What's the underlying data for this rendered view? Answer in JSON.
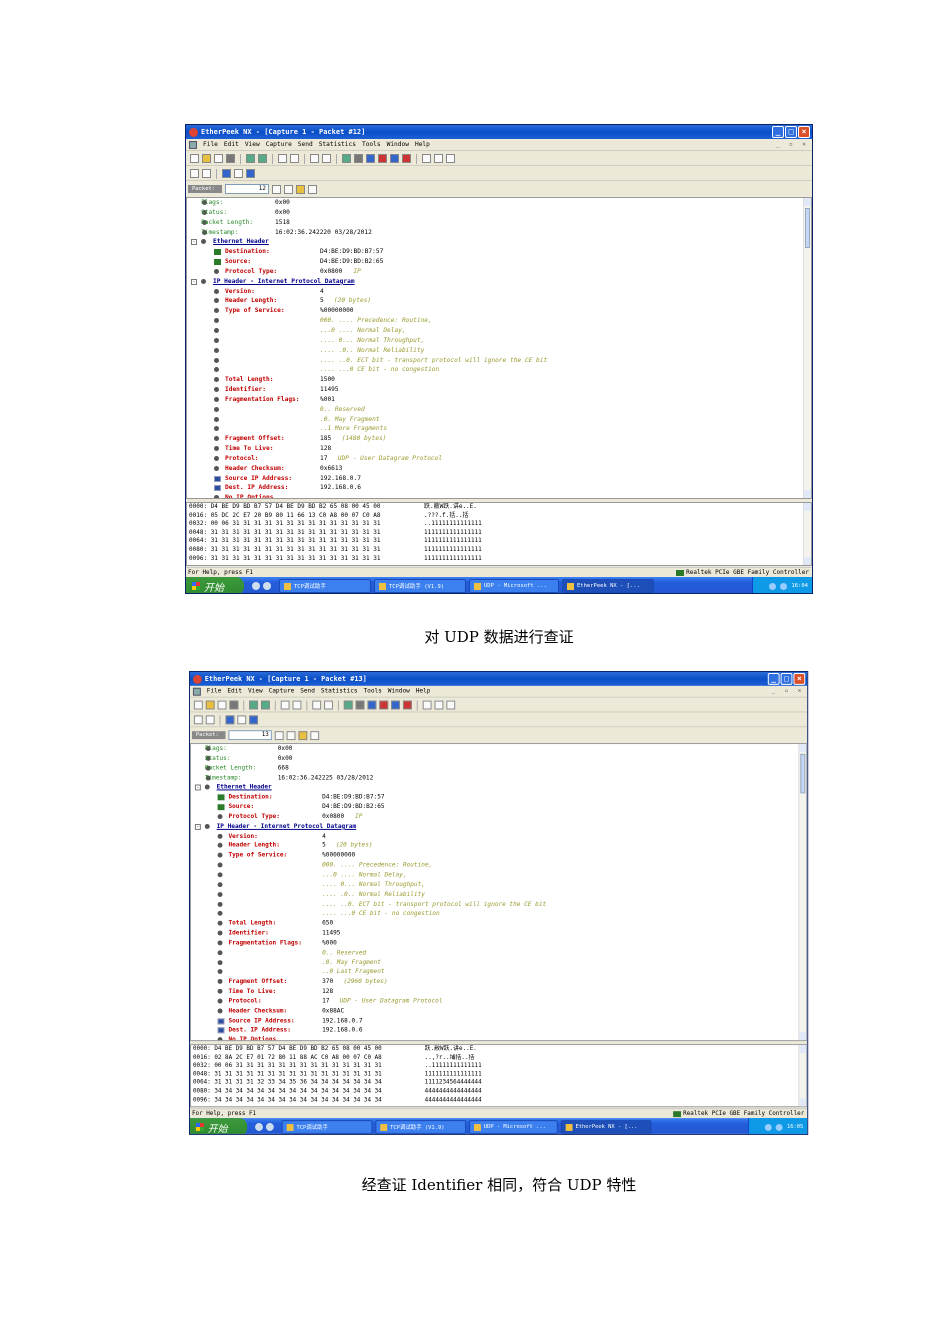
{
  "windows": [
    {
      "title": "EtherPeek NX - [Capture 1 - Packet #12]",
      "menu": [
        "File",
        "Edit",
        "View",
        "Capture",
        "Send",
        "Statistics",
        "Tools",
        "Window",
        "Help"
      ],
      "packet_label": "Packet:",
      "packet_number": "12",
      "tree": [
        {
          "k": "g",
          "l": "Flags:",
          "v": "0x00"
        },
        {
          "k": "g",
          "l": "Status:",
          "v": "0x00"
        },
        {
          "k": "g",
          "l": "Packet Length:",
          "v": "1518"
        },
        {
          "k": "g",
          "l": "Timestamp:",
          "v": "16:02:36.242220 03/28/2012"
        },
        {
          "k": "h",
          "l": "Ethernet Header"
        },
        {
          "k": "f",
          "i": "nic",
          "l": "Destination:",
          "v": "D4:BE:D9:BD:B7:57"
        },
        {
          "k": "f",
          "i": "nic",
          "l": "Source:",
          "v": "D4:BE:D9:BD:B2:65"
        },
        {
          "k": "f",
          "l": "Protocol Type:",
          "v": "0x0800",
          "n": "IP"
        },
        {
          "k": "h",
          "l": "IP Header - Internet Protocol Datagram"
        },
        {
          "k": "f",
          "l": "Version:",
          "v": "4"
        },
        {
          "k": "f",
          "l": "Header Length:",
          "v": "5",
          "n": "(20  bytes)"
        },
        {
          "k": "f",
          "l": "Type of Service:",
          "v": "%00000000"
        },
        {
          "k": "b",
          "n": "000. .... Precedence: Routine,"
        },
        {
          "k": "b",
          "n": "...0 .... Normal Delay,"
        },
        {
          "k": "b",
          "n": ".... 0... Normal Throughput,"
        },
        {
          "k": "b",
          "n": ".... .0.. Normal Reliability"
        },
        {
          "k": "b",
          "n": ".... ..0. ECT bit - transport protocol will ignore the CE bit"
        },
        {
          "k": "b",
          "n": ".... ...0 CE bit - no congestion"
        },
        {
          "k": "f",
          "l": "Total Length:",
          "v": "1500"
        },
        {
          "k": "f",
          "l": "Identifier:",
          "v": "11495"
        },
        {
          "k": "f",
          "l": "Fragmentation Flags:",
          "v": "%001"
        },
        {
          "k": "b",
          "n": "0.. Reserved"
        },
        {
          "k": "b",
          "n": ".0. May Fragment"
        },
        {
          "k": "b",
          "n": "..1 More Fragments"
        },
        {
          "k": "f",
          "l": "Fragment Offset:",
          "v": "185",
          "n": "(1480  bytes)"
        },
        {
          "k": "f",
          "l": "Time To Live:",
          "v": "128"
        },
        {
          "k": "f",
          "l": "Protocol:",
          "v": "17",
          "n": "UDP - User Datagram Protocol"
        },
        {
          "k": "f",
          "l": "Header Checksum:",
          "v": "0x6613"
        },
        {
          "k": "f",
          "i": "pc",
          "l": "Source IP Address:",
          "v": "192.168.0.7"
        },
        {
          "k": "f",
          "i": "pc",
          "l": "Dest. IP Address:",
          "v": "192.168.0.6"
        },
        {
          "k": "f",
          "l": "No IP Options"
        }
      ],
      "hex": [
        {
          "o": "0000:",
          "h": "D4 BE D9 BD B7 57 D4 BE D9 BD B2 65 08 00 45 00",
          "a": "跃.敝W跃.讲e..E."
        },
        {
          "o": "0016:",
          "h": "05 DC 2C E7 20 B9 80 11 66 13 C0 A8 00 07 C0 A8",
          "a": ".???.f.括..括"
        },
        {
          "o": "0032:",
          "h": "00 06 31 31 31 31 31 31 31 31 31 31 31 31 31 31",
          "a": "..11111111111111"
        },
        {
          "o": "0048:",
          "h": "31 31 31 31 31 31 31 31 31 31 31 31 31 31 31 31",
          "a": "1111111111111111"
        },
        {
          "o": "0064:",
          "h": "31 31 31 31 31 31 31 31 31 31 31 31 31 31 31 31",
          "a": "1111111111111111"
        },
        {
          "o": "0080:",
          "h": "31 31 31 31 31 31 31 31 31 31 31 31 31 31 31 31",
          "a": "1111111111111111"
        },
        {
          "o": "0096:",
          "h": "31 31 31 31 31 31 31 31 31 31 31 31 31 31 31 31",
          "a": "1111111111111111"
        }
      ],
      "status_help": "For Help, press F1",
      "status_adapter": "Realtek PCIe GBE Family Controller",
      "start_label": "开始",
      "tasks": [
        "TCP调试助手",
        "TCP调试助手 (V1.9)",
        "UDP - Microsoft ...",
        "EtherPeek NX - [..."
      ],
      "clock": "16:04"
    },
    {
      "title": "EtherPeek NX - [Capture 1 - Packet #13]",
      "menu": [
        "File",
        "Edit",
        "View",
        "Capture",
        "Send",
        "Statistics",
        "Tools",
        "Window",
        "Help"
      ],
      "packet_label": "Packet:",
      "packet_number": "13",
      "tree": [
        {
          "k": "g",
          "l": "Flags:",
          "v": "0x00"
        },
        {
          "k": "g",
          "l": "Status:",
          "v": "0x00"
        },
        {
          "k": "g",
          "l": "Packet Length:",
          "v": "668"
        },
        {
          "k": "g",
          "l": "Timestamp:",
          "v": "16:02:36.242225 03/28/2012"
        },
        {
          "k": "h",
          "l": "Ethernet Header"
        },
        {
          "k": "f",
          "i": "nic",
          "l": "Destination:",
          "v": "D4:BE:D9:BD:B7:57"
        },
        {
          "k": "f",
          "i": "nic",
          "l": "Source:",
          "v": "D4:BE:D9:BD:B2:65"
        },
        {
          "k": "f",
          "l": "Protocol Type:",
          "v": "0x0800",
          "n": "IP"
        },
        {
          "k": "h",
          "l": "IP Header - Internet Protocol Datagram"
        },
        {
          "k": "f",
          "l": "Version:",
          "v": "4"
        },
        {
          "k": "f",
          "l": "Header Length:",
          "v": "5",
          "n": "(20  bytes)"
        },
        {
          "k": "f",
          "l": "Type of Service:",
          "v": "%00000000"
        },
        {
          "k": "b",
          "n": "000. .... Precedence: Routine,"
        },
        {
          "k": "b",
          "n": "...0 .... Normal Delay,"
        },
        {
          "k": "b",
          "n": ".... 0... Normal Throughput,"
        },
        {
          "k": "b",
          "n": ".... .0.. Normal Reliability"
        },
        {
          "k": "b",
          "n": ".... ..0. ECT bit - transport protocol will ignore the CE bit"
        },
        {
          "k": "b",
          "n": ".... ...0 CE bit - no congestion"
        },
        {
          "k": "f",
          "l": "Total Length:",
          "v": "650"
        },
        {
          "k": "f",
          "l": "Identifier:",
          "v": "11495"
        },
        {
          "k": "f",
          "l": "Fragmentation Flags:",
          "v": "%000"
        },
        {
          "k": "b",
          "n": "0.. Reserved"
        },
        {
          "k": "b",
          "n": ".0. May Fragment"
        },
        {
          "k": "b",
          "n": "..0 Last Fragment"
        },
        {
          "k": "f",
          "l": "Fragment Offset:",
          "v": "370",
          "n": "(2960  bytes)"
        },
        {
          "k": "f",
          "l": "Time To Live:",
          "v": "128"
        },
        {
          "k": "f",
          "l": "Protocol:",
          "v": "17",
          "n": "UDP - User Datagram Protocol"
        },
        {
          "k": "f",
          "l": "Header Checksum:",
          "v": "0x88AC"
        },
        {
          "k": "f",
          "i": "pc",
          "l": "Source IP Address:",
          "v": "192.168.0.7"
        },
        {
          "k": "f",
          "i": "pc",
          "l": "Dest. IP Address:",
          "v": "192.168.0.6"
        },
        {
          "k": "f",
          "l": "No IP Options"
        }
      ],
      "hex": [
        {
          "o": "0000:",
          "h": "D4 BE D9 BD B7 57 D4 BE D9 BD B2 65 08 00 45 00",
          "a": "跃.敝W跃.讲e..E."
        },
        {
          "o": "0016:",
          "h": "02 8A 2C E7 01 72 80 11 88 AC C0 A8 00 07 C0 A8",
          "a": "..,?r..埔括..括"
        },
        {
          "o": "0032:",
          "h": "00 06 31 31 31 31 31 31 31 31 31 31 31 31 31 31",
          "a": "..11111111111111"
        },
        {
          "o": "0048:",
          "h": "31 31 31 31 31 31 31 31 31 31 31 31 31 31 31 31",
          "a": "1111111111111111"
        },
        {
          "o": "0064:",
          "h": "31 31 31 31 32 33 34 35 36 34 34 34 34 34 34 34",
          "a": "1111234564444444"
        },
        {
          "o": "0080:",
          "h": "34 34 34 34 34 34 34 34 34 34 34 34 34 34 34 34",
          "a": "4444444444444444"
        },
        {
          "o": "0096:",
          "h": "34 34 34 34 34 34 34 34 34 34 34 34 34 34 34 34",
          "a": "4444444444444444"
        }
      ],
      "status_help": "For Help, press F1",
      "status_adapter": "Realtek PCIe GBE Family Controller",
      "start_label": "开始",
      "tasks": [
        "TCP调试助手",
        "TCP调试助手 (V1.9)",
        "UDP - Microsoft ...",
        "EtherPeek NX - [..."
      ],
      "clock": "16:05"
    }
  ],
  "captions": [
    "对 UDP 数据进行查证",
    "经查证 Identifier 相同，符合 UDP 特性"
  ]
}
